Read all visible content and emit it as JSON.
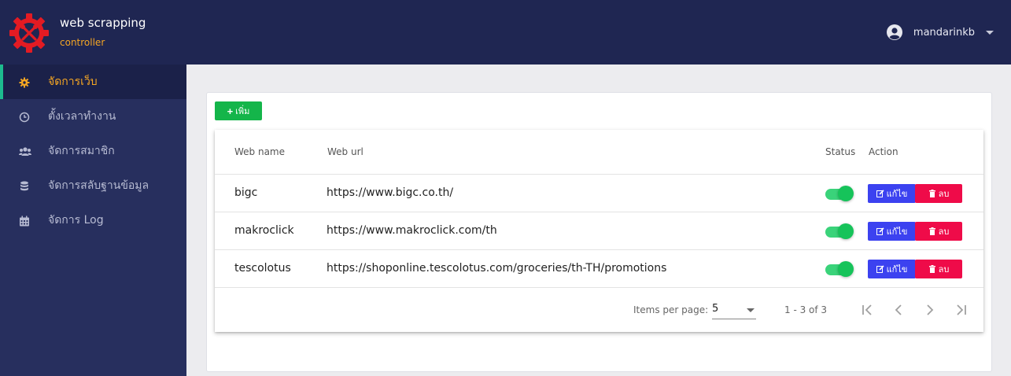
{
  "header": {
    "brand_title": "web scrapping",
    "brand_subtitle": "controller",
    "username": "mandarinkb"
  },
  "sidebar": {
    "items": [
      {
        "label": "จัดการเว็บ",
        "icon": "gear-icon",
        "active": true
      },
      {
        "label": "ตั้งเวลาทำงาน",
        "icon": "clock-icon",
        "active": false
      },
      {
        "label": "จัดการสมาชิก",
        "icon": "users-icon",
        "active": false
      },
      {
        "label": "จัดการสลับฐานข้อมูล",
        "icon": "database-icon",
        "active": false
      },
      {
        "label": "จัดการ Log",
        "icon": "calendar-icon",
        "active": false
      }
    ]
  },
  "toolbar": {
    "add_label": "เพิ่ม"
  },
  "table": {
    "columns": [
      "Web name",
      "Web url",
      "Status",
      "Action"
    ],
    "rows": [
      {
        "name": "bigc",
        "url": "https://www.bigc.co.th/",
        "status": true
      },
      {
        "name": "makroclick",
        "url": "https://www.makroclick.com/th",
        "status": true
      },
      {
        "name": "tescolotus",
        "url": "https://shoponline.tescolotus.com/groceries/th-TH/promotions",
        "status": true
      }
    ],
    "edit_label": "แก้ไข",
    "delete_label": "ลบ"
  },
  "paginator": {
    "items_per_page_label": "Items per page:",
    "items_per_page_value": "5",
    "range_label": "1 - 3 of 3"
  },
  "colors": {
    "topbar": "#1f2652",
    "sidebar": "#272f5e",
    "active_text": "#f5a623",
    "add_button": "#14b54a",
    "edit_button": "#3c42f0",
    "delete_button": "#ef0b49",
    "toggle_on": "#16c35a"
  }
}
